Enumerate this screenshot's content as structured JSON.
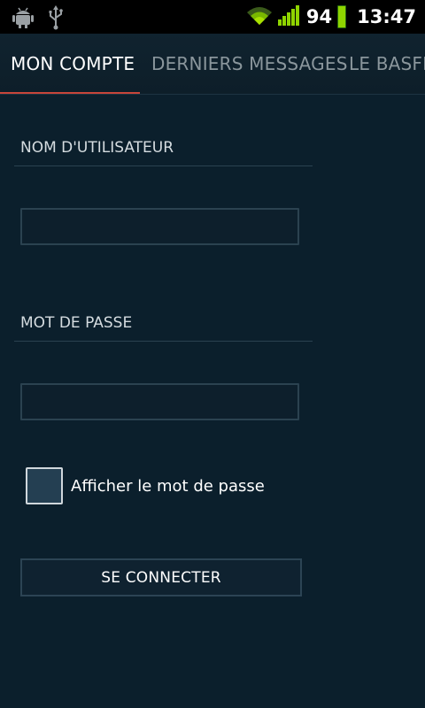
{
  "status_bar": {
    "icons_left": [
      "android-debug-icon",
      "usb-icon"
    ],
    "icons_right": [
      "wifi-icon",
      "signal-icon",
      "battery-icon"
    ],
    "battery_level": "94",
    "time": "13:47"
  },
  "tabs": [
    {
      "label": "MON COMPTE",
      "active": true
    },
    {
      "label": "DERNIERS MESSAGES",
      "active": false
    },
    {
      "label": "LE BASFI",
      "active": false
    }
  ],
  "form": {
    "username_label": "NOM D'UTILISATEUR",
    "username_value": "",
    "password_label": "MOT DE PASSE",
    "password_value": "",
    "show_password_label": "Afficher le mot de passe",
    "show_password_checked": false,
    "submit_label": "SE CONNECTER"
  },
  "colors": {
    "background": "#0b1f2c",
    "tab_indicator": "#c8453a",
    "battery": "#8fd400"
  }
}
